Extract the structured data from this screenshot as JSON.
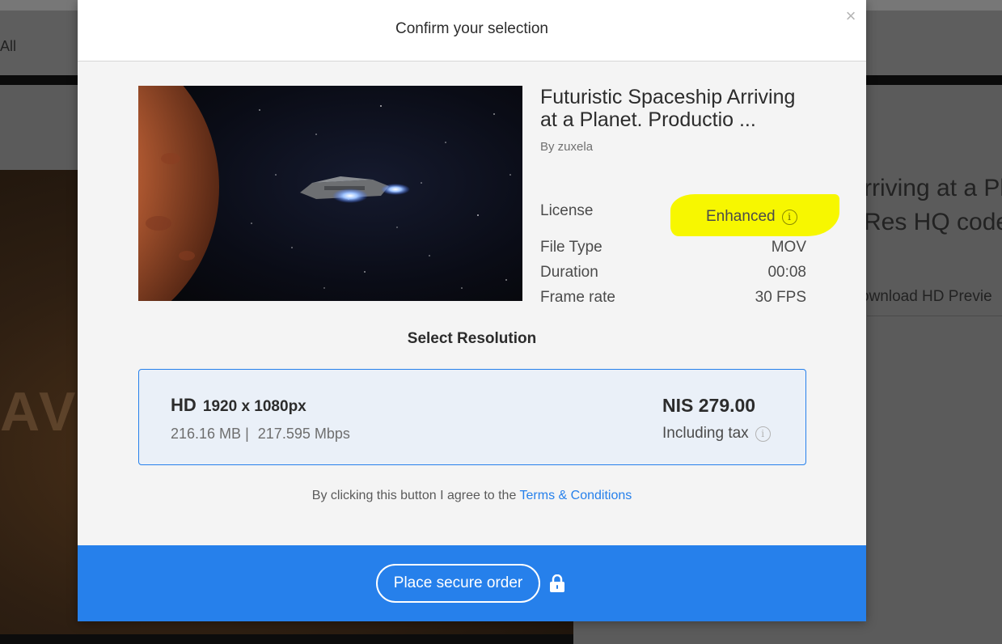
{
  "background": {
    "nav_label": "All",
    "title_line1": "rriving at a Pla",
    "title_line2": "Res HQ codec",
    "download_link": "ownload HD Previe",
    "overlay_letters": "AV"
  },
  "modal": {
    "title": "Confirm your selection",
    "close_label": "×",
    "clip": {
      "title": "Futuristic Spaceship Arriving at a Planet. Productio ...",
      "author": "By zuxela"
    },
    "details": {
      "license_label": "License",
      "license_value": "Enhanced",
      "file_type_label": "File Type",
      "file_type_value": "MOV",
      "duration_label": "Duration",
      "duration_value": "00:08",
      "frame_rate_label": "Frame rate",
      "frame_rate_value": "30 FPS"
    },
    "select_resolution_label": "Select Resolution",
    "resolution": {
      "name": "HD",
      "dimensions": "1920 x 1080px",
      "size": "216.16 MB",
      "separator": "|",
      "bitrate": "217.595 Mbps",
      "price": "NIS 279.00",
      "tax_note": "Including tax"
    },
    "terms": {
      "prefix": "By clicking this button I agree to the",
      "link": "Terms & Conditions"
    },
    "order_button": "Place secure order"
  },
  "icons": {
    "info": "i",
    "close": "close-icon",
    "lock": "lock-icon"
  },
  "colors": {
    "accent": "#2680eb",
    "highlight": "#f7f700",
    "selected_bg": "#eaf0f8"
  }
}
